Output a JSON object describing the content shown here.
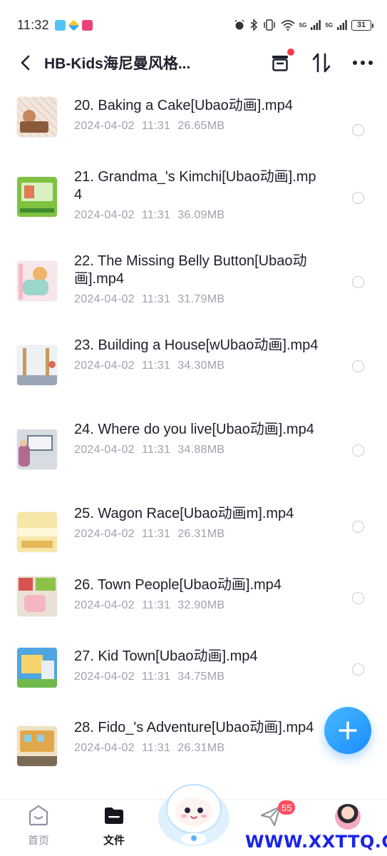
{
  "status_bar": {
    "time": "11:32",
    "battery": "31",
    "signal_1": "5G",
    "signal_2": "5G"
  },
  "header": {
    "title": "HB-Kids海尼曼风格..."
  },
  "files": [
    {
      "name": "20. Baking a Cake[Ubao动画].mp4",
      "date": "2024-04-02",
      "time": "11:31",
      "size": "26.65MB"
    },
    {
      "name": "21. Grandma_'s Kimchi[Ubao动画].mp4",
      "date": "2024-04-02",
      "time": "11:31",
      "size": "36.09MB"
    },
    {
      "name": "22. The Missing Belly Button[Ubao动画].mp4",
      "date": "2024-04-02",
      "time": "11:31",
      "size": "31.79MB"
    },
    {
      "name": "23. Building a House[wUbao动画].mp4",
      "date": "2024-04-02",
      "time": "11:31",
      "size": "34.30MB"
    },
    {
      "name": "24. Where do you live[Ubao动画].mp4",
      "date": "2024-04-02",
      "time": "11:31",
      "size": "34.88MB"
    },
    {
      "name": "25. Wagon Race[Ubao动画m].mp4",
      "date": "2024-04-02",
      "time": "11:31",
      "size": "26.31MB"
    },
    {
      "name": "26. Town People[Ubao动画].mp4",
      "date": "2024-04-02",
      "time": "11:31",
      "size": "32.90MB"
    },
    {
      "name": "27. Kid Town[Ubao动画].mp4",
      "date": "2024-04-02",
      "time": "11:31",
      "size": "34.75MB"
    },
    {
      "name": "28. Fido_'s Adventure[Ubao动画].mp4",
      "date": "2024-04-02",
      "time": "11:31",
      "size": "26.31MB"
    }
  ],
  "bottom_nav": {
    "home_label": "首页",
    "files_label": "文件",
    "share_badge": "55"
  },
  "watermark": "WWW.XXTTQ.COM",
  "colors": {
    "accent": "#1a8cff",
    "badge": "#ff4d5e",
    "meta_text": "#9ea2ae",
    "watermark": "#1a24e6"
  }
}
